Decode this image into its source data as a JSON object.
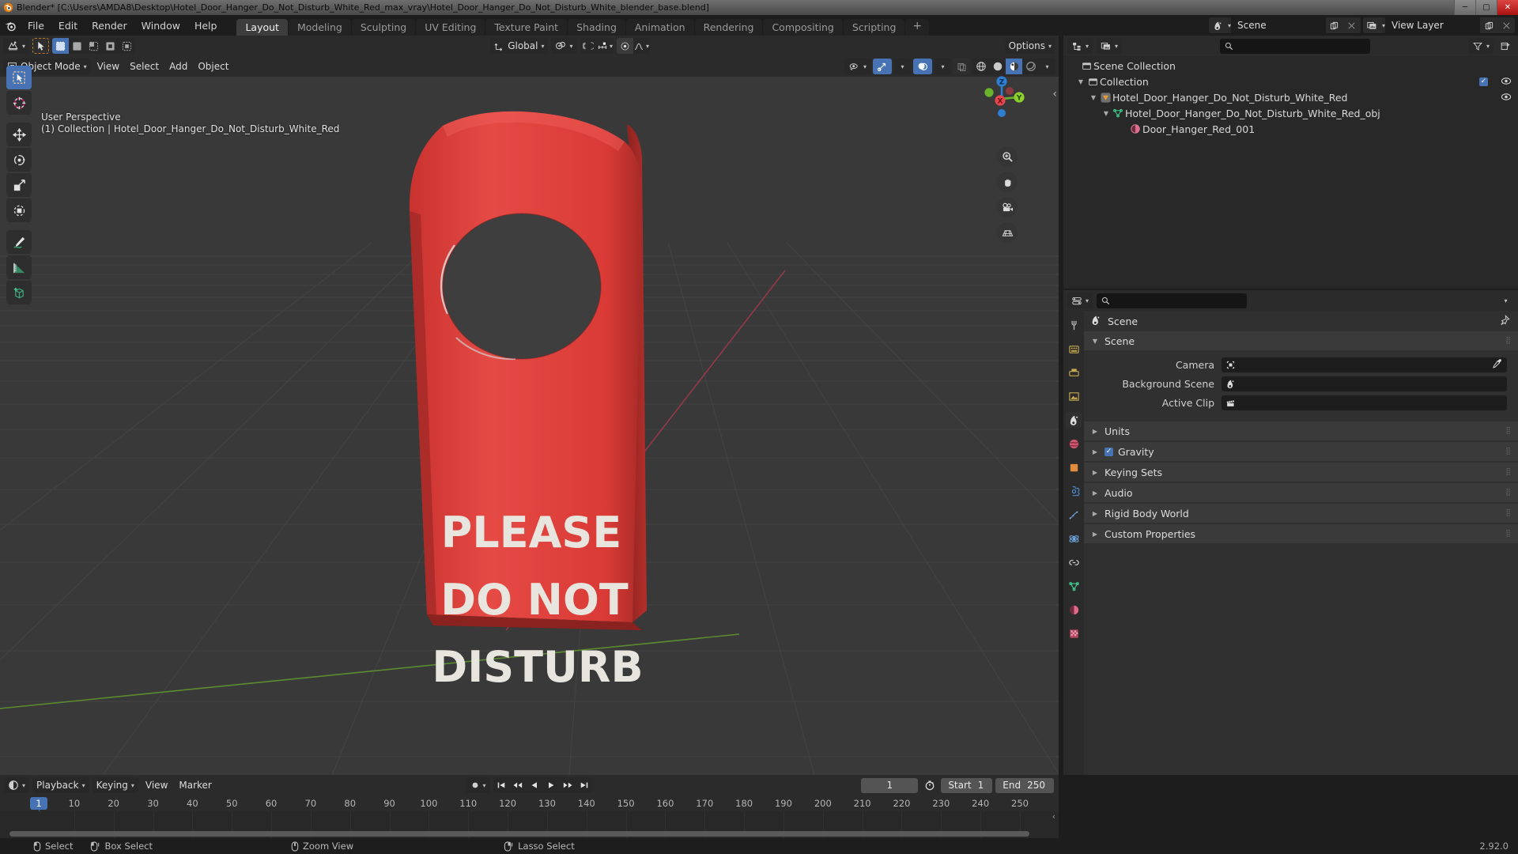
{
  "window": {
    "title": "Blender* [C:\\Users\\AMDA8\\Desktop\\Hotel_Door_Hanger_Do_Not_Disturb_White_Red_max_vray\\Hotel_Door_Hanger_Do_Not_Disturb_White_blender_base.blend]",
    "minimize": "─",
    "maximize": "▢",
    "close": "✕"
  },
  "topbar": {
    "menus": [
      "File",
      "Edit",
      "Render",
      "Window",
      "Help"
    ],
    "workspaces": [
      {
        "label": "Layout",
        "active": true
      },
      {
        "label": "Modeling",
        "active": false
      },
      {
        "label": "Sculpting",
        "active": false
      },
      {
        "label": "UV Editing",
        "active": false
      },
      {
        "label": "Texture Paint",
        "active": false
      },
      {
        "label": "Shading",
        "active": false
      },
      {
        "label": "Animation",
        "active": false
      },
      {
        "label": "Rendering",
        "active": false
      },
      {
        "label": "Compositing",
        "active": false
      },
      {
        "label": "Scripting",
        "active": false
      }
    ],
    "add_workspace": "+",
    "scene_name": "Scene",
    "view_layer_name": "View Layer"
  },
  "viewport": {
    "mode": "Object Mode",
    "menus": [
      "View",
      "Select",
      "Add",
      "Object"
    ],
    "transform_orientation": "Global",
    "options_label": "Options",
    "overlay_line1": "User Perspective",
    "overlay_line2": "(1) Collection | Hotel_Door_Hanger_Do_Not_Disturb_White_Red",
    "gizmo_axes": {
      "x": "X",
      "y": "Y",
      "z": "Z"
    },
    "hanger_text_lines": [
      "PLEASE",
      "DO NOT",
      "DISTURB"
    ],
    "hanger_color": "#e0393c",
    "background_color": "#393939"
  },
  "outliner": {
    "search_placeholder": "",
    "rows": [
      {
        "label": "Scene Collection",
        "depth": 0,
        "icon": "collection-icon",
        "expander": "",
        "checkbox": false,
        "eye": false
      },
      {
        "label": "Collection",
        "depth": 1,
        "icon": "collection-icon",
        "expander": "▼",
        "checkbox": true,
        "eye": true
      },
      {
        "label": "Hotel_Door_Hanger_Do_Not_Disturb_White_Red",
        "depth": 2,
        "icon": "empty-object-icon",
        "expander": "▼",
        "checkbox": false,
        "eye": true
      },
      {
        "label": "Hotel_Door_Hanger_Do_Not_Disturb_White_Red_obj",
        "depth": 3,
        "icon": "mesh-data-icon",
        "expander": "▼",
        "checkbox": false,
        "eye": false
      },
      {
        "label": "Door_Hanger_Red_001",
        "depth": 4,
        "icon": "material-icon",
        "expander": "",
        "checkbox": false,
        "eye": false
      }
    ]
  },
  "properties": {
    "breadcrumb": "Scene",
    "panels": [
      {
        "label": "Scene",
        "open": true,
        "checkbox": null
      },
      {
        "label": "Units",
        "open": false,
        "checkbox": null
      },
      {
        "label": "Gravity",
        "open": false,
        "checkbox": true
      },
      {
        "label": "Keying Sets",
        "open": false,
        "checkbox": null
      },
      {
        "label": "Audio",
        "open": false,
        "checkbox": null
      },
      {
        "label": "Rigid Body World",
        "open": false,
        "checkbox": null
      },
      {
        "label": "Custom Properties",
        "open": false,
        "checkbox": null
      }
    ],
    "scene_fields": [
      {
        "label": "Camera",
        "value": "",
        "icon": "camera-icon"
      },
      {
        "label": "Background Scene",
        "value": "",
        "icon": "scene-icon"
      },
      {
        "label": "Active Clip",
        "value": "",
        "icon": "clip-icon"
      }
    ]
  },
  "timeline": {
    "playback_label": "Playback",
    "keying_label": "Keying",
    "view_label": "View",
    "marker_label": "Marker",
    "current_frame": "1",
    "start_label": "Start",
    "start_value": "1",
    "end_label": "End",
    "end_value": "250",
    "ticks": [
      "1",
      "10",
      "20",
      "30",
      "40",
      "50",
      "60",
      "70",
      "80",
      "90",
      "100",
      "110",
      "120",
      "130",
      "140",
      "150",
      "160",
      "170",
      "180",
      "190",
      "200",
      "210",
      "220",
      "230",
      "240",
      "250"
    ],
    "playhead_frame": "1"
  },
  "statusbar": {
    "items": [
      {
        "label": "Select",
        "icon": "mouse-left-icon"
      },
      {
        "label": "Box Select",
        "icon": "mouse-left-drag-icon"
      },
      {
        "label": "Zoom View",
        "icon": "mouse-middle-icon"
      },
      {
        "label": "Lasso Select",
        "icon": "mouse-right-drag-icon"
      }
    ],
    "version": "2.92.0"
  }
}
